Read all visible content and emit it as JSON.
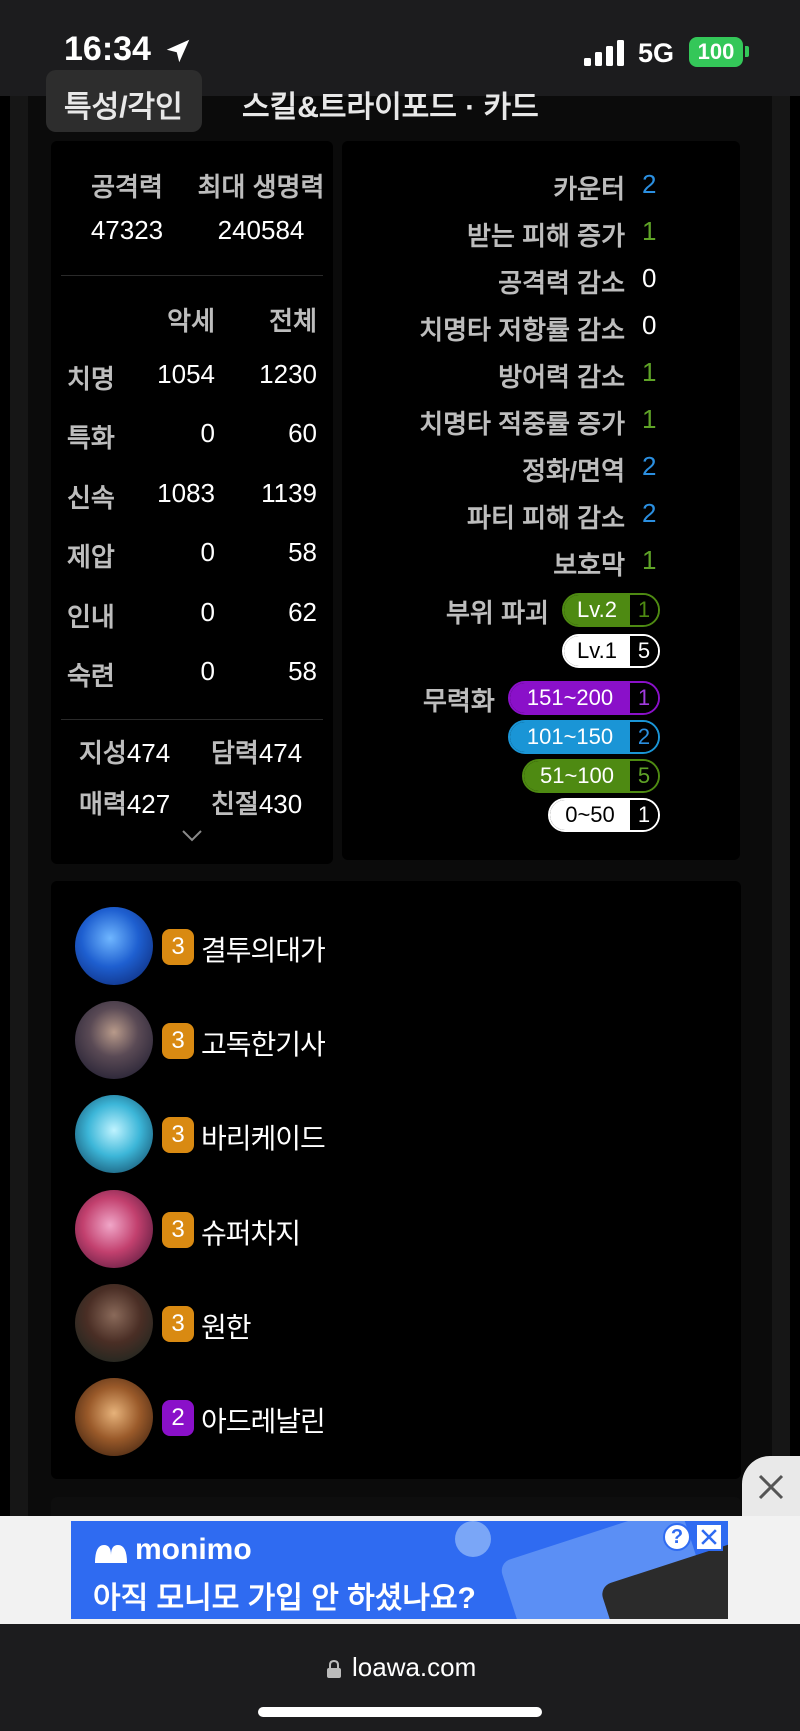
{
  "status_bar": {
    "time": "16:34",
    "network": "5G",
    "battery": "100"
  },
  "tabs": {
    "active_label": "특성/각인",
    "other_label": "스킬&트라이포드 · 카드"
  },
  "stats": {
    "headline": [
      {
        "label": "공격력",
        "value": "47323"
      },
      {
        "label": "최대 생명력",
        "value": "240584"
      }
    ],
    "col_headers": [
      "악세",
      "전체"
    ],
    "rows": [
      {
        "label": "치명",
        "acc": "1054",
        "total": "1230"
      },
      {
        "label": "특화",
        "acc": "0",
        "total": "60"
      },
      {
        "label": "신속",
        "acc": "1083",
        "total": "1139"
      },
      {
        "label": "제압",
        "acc": "0",
        "total": "58"
      },
      {
        "label": "인내",
        "acc": "0",
        "total": "62"
      },
      {
        "label": "숙련",
        "acc": "0",
        "total": "58"
      }
    ],
    "attributes": [
      {
        "label": "지성",
        "value": "474"
      },
      {
        "label": "담력",
        "value": "474"
      },
      {
        "label": "매력",
        "value": "427"
      },
      {
        "label": "친절",
        "value": "430"
      }
    ]
  },
  "synergy": {
    "rows": [
      {
        "label": "카운터",
        "value": "2",
        "color": "#2b8fe0"
      },
      {
        "label": "받는 피해 증가",
        "value": "1",
        "color": "#5fa327"
      },
      {
        "label": "공격력 감소",
        "value": "0",
        "color": "#ffffff"
      },
      {
        "label": "치명타 저항률 감소",
        "value": "0",
        "color": "#ffffff"
      },
      {
        "label": "방어력 감소",
        "value": "1",
        "color": "#5fa327"
      },
      {
        "label": "치명타 적중률 증가",
        "value": "1",
        "color": "#5fa327"
      },
      {
        "label": "정화/면역",
        "value": "2",
        "color": "#2b8fe0"
      },
      {
        "label": "파티 피해 감소",
        "value": "2",
        "color": "#2b8fe0"
      },
      {
        "label": "보호막",
        "value": "1",
        "color": "#5fa327"
      }
    ],
    "part_break": {
      "label": "부위 파괴",
      "levels": [
        {
          "label": "Lv.2",
          "count": "1",
          "color": "#4e8a12",
          "text": "#ffffff"
        },
        {
          "label": "Lv.1",
          "count": "5",
          "color": "#ffffff",
          "text": "#000000"
        }
      ]
    },
    "stagger": {
      "label": "무력화",
      "levels": [
        {
          "label": "151~200",
          "count": "1",
          "color": "#8a10c9",
          "text": "#ffffff"
        },
        {
          "label": "101~150",
          "count": "2",
          "color": "#1a95d6",
          "text": "#ffffff"
        },
        {
          "label": "51~100",
          "count": "5",
          "color": "#4e8a12",
          "text": "#ffffff"
        },
        {
          "label": "0~50",
          "count": "1",
          "color": "#ffffff",
          "text": "#000000"
        }
      ]
    }
  },
  "engravings": [
    {
      "level": "3",
      "name": "결투의대가",
      "badge_color": "#d98a12",
      "icon": "duel-master-icon"
    },
    {
      "level": "3",
      "name": "고독한기사",
      "badge_color": "#d98a12",
      "icon": "lone-knight-icon"
    },
    {
      "level": "3",
      "name": "바리케이드",
      "badge_color": "#d98a12",
      "icon": "barricade-icon"
    },
    {
      "level": "3",
      "name": "슈퍼차지",
      "badge_color": "#d98a12",
      "icon": "super-charge-icon"
    },
    {
      "level": "3",
      "name": "원한",
      "badge_color": "#d98a12",
      "icon": "grudge-icon"
    },
    {
      "level": "2",
      "name": "아드레날린",
      "badge_color": "#8a10c9",
      "icon": "adrenaline-icon"
    }
  ],
  "ad": {
    "brand": "monimo",
    "text": "아직 모니모 가입 안 하셨나요?",
    "help": "?"
  },
  "browser": {
    "url": "loawa.com"
  }
}
